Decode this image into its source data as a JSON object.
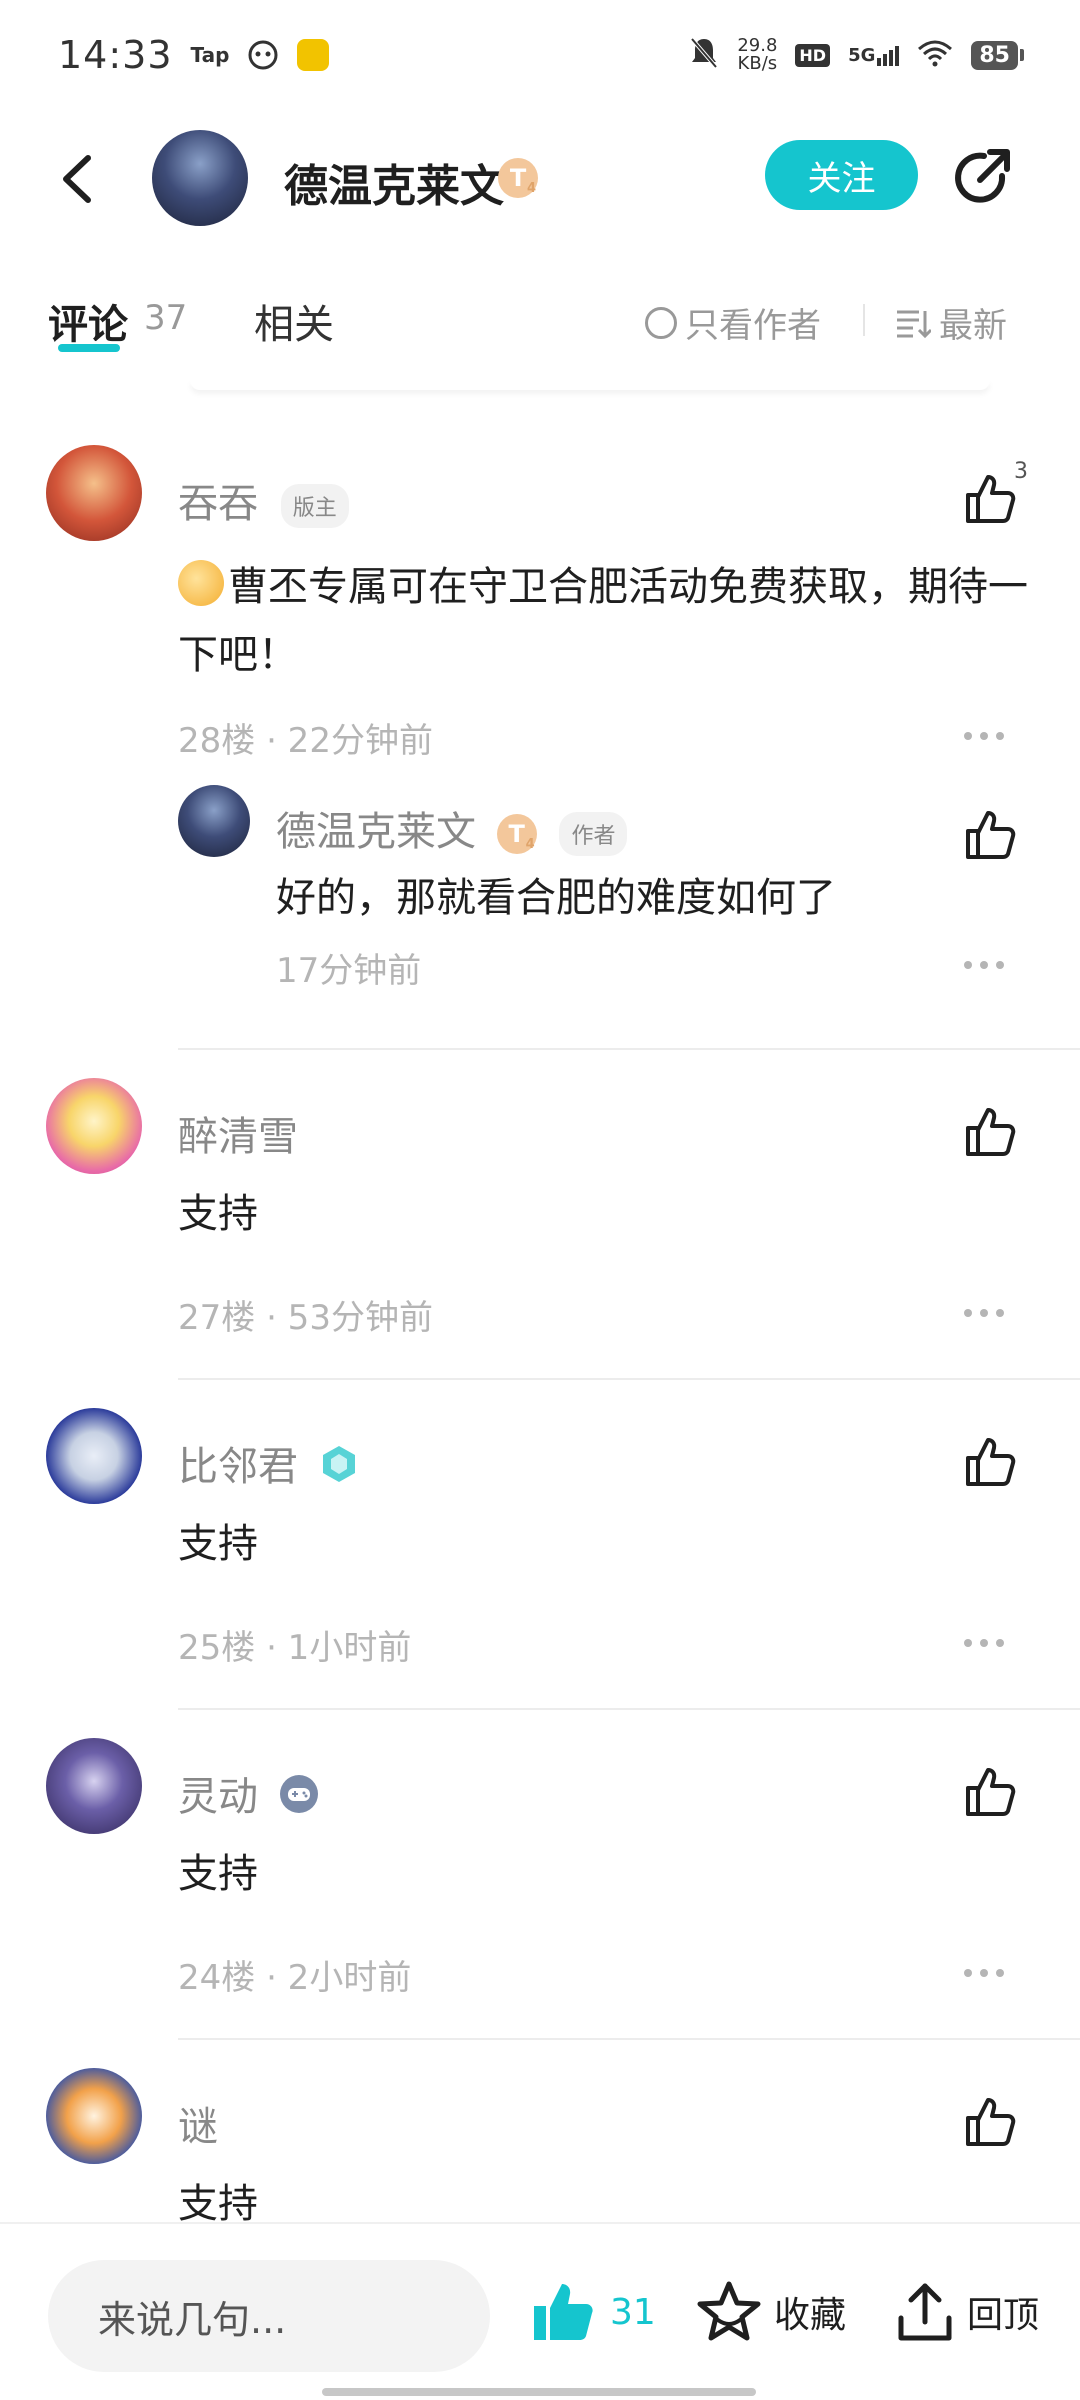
{
  "status_bar": {
    "time": "14:33",
    "app_label": "Tap",
    "net_speed_value": "29.8",
    "net_speed_unit": "KB/s",
    "hd": "HD",
    "network": "5G",
    "battery": "85"
  },
  "header": {
    "title": "德温克莱文",
    "level_badge": "T",
    "level_sub": "4",
    "follow_label": "关注"
  },
  "tabs": {
    "comments_label": "评论",
    "comments_count": "37",
    "related_label": "相关",
    "only_author_label": "只看作者",
    "sort_label": "最新"
  },
  "comments": [
    {
      "name": "吞吞",
      "tag": "版主",
      "text": "曹丕专属可在守卫合肥活动免费获取，期待一下吧！",
      "meta": "28楼 · 22分钟前",
      "like_count": "3",
      "reply": {
        "name": "德温克莱文",
        "level_badge": "T",
        "level_sub": "4",
        "tag": "作者",
        "text": "好的，那就看合肥的难度如何了",
        "meta": "17分钟前"
      }
    },
    {
      "name": "醉清雪",
      "text": "支持",
      "meta": "27楼 · 53分钟前"
    },
    {
      "name": "比邻君",
      "text": "支持",
      "meta": "25楼 · 1小时前"
    },
    {
      "name": "灵动",
      "text": "支持",
      "meta": "24楼 · 2小时前"
    },
    {
      "name": "谜",
      "text": "支持"
    }
  ],
  "bottom_bar": {
    "input_placeholder": "来说几句...",
    "like_count": "31",
    "favorite_label": "收藏",
    "back_top_label": "回顶"
  },
  "colors": {
    "accent": "#15c5ce",
    "text_primary": "#1f1f1f",
    "text_secondary": "#888888",
    "text_meta": "#b5b5b5"
  }
}
